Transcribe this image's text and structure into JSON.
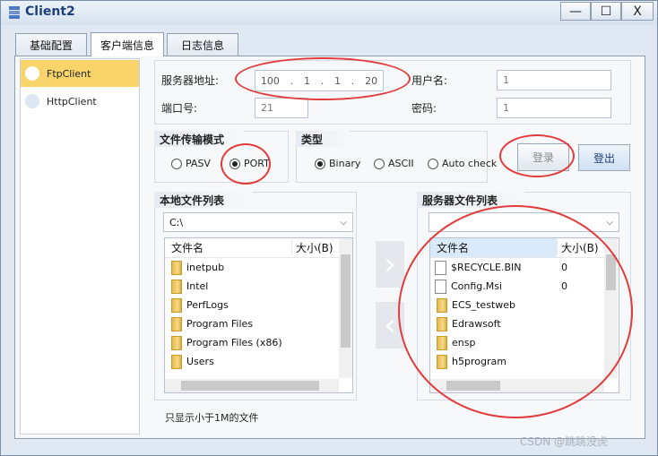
{
  "window": {
    "title": "Client2",
    "minimize": "—",
    "maximize": "☐",
    "close": "X"
  },
  "tabs": [
    {
      "label": "基础配置"
    },
    {
      "label": "客户端信息"
    },
    {
      "label": "日志信息"
    }
  ],
  "clients": [
    {
      "label": "FtpClient"
    },
    {
      "label": "HttpClient"
    }
  ],
  "server": {
    "address_label": "服务器地址:",
    "ip": [
      "100",
      ".",
      "1",
      ".",
      "1",
      ".",
      "20"
    ],
    "username_label": "用户名:",
    "username_value": "1",
    "port_label": "端口号:",
    "port_value": "21",
    "password_label": "密码:",
    "password_value": "1"
  },
  "transfer_mode": {
    "title": "文件传输模式",
    "options": [
      {
        "label": "PASV"
      },
      {
        "label": "PORT"
      }
    ]
  },
  "type": {
    "title": "类型",
    "options": [
      {
        "label": "Binary"
      },
      {
        "label": "ASCII"
      },
      {
        "label": "Auto check"
      }
    ]
  },
  "buttons": {
    "login": "登录",
    "logout": "登出"
  },
  "local": {
    "title": "本地文件列表",
    "path": "C:\\",
    "col_name": "文件名",
    "col_size": "大小(B)",
    "files": [
      {
        "name": "inetpub"
      },
      {
        "name": "Intel"
      },
      {
        "name": "PerfLogs"
      },
      {
        "name": "Program Files"
      },
      {
        "name": "Program Files (x86)"
      },
      {
        "name": "Users"
      }
    ]
  },
  "remote": {
    "title": "服务器文件列表",
    "path": "",
    "col_name": "文件名",
    "col_size": "大小(B)",
    "files": [
      {
        "name": "$RECYCLE.BIN",
        "size": "0"
      },
      {
        "name": "Config.Msi",
        "size": "0"
      },
      {
        "name": "ECS_testweb",
        "size": ""
      },
      {
        "name": "Edrawsoft",
        "size": ""
      },
      {
        "name": "ensp",
        "size": ""
      },
      {
        "name": "h5program",
        "size": ""
      }
    ]
  },
  "footer_note": "只显示小于1M的文件",
  "watermark": "CSDN @跳跳没虎",
  "colors": {
    "annotation": "#e23b3b",
    "selected_item": "#f9d46a",
    "accent": "#1d3f7a"
  }
}
